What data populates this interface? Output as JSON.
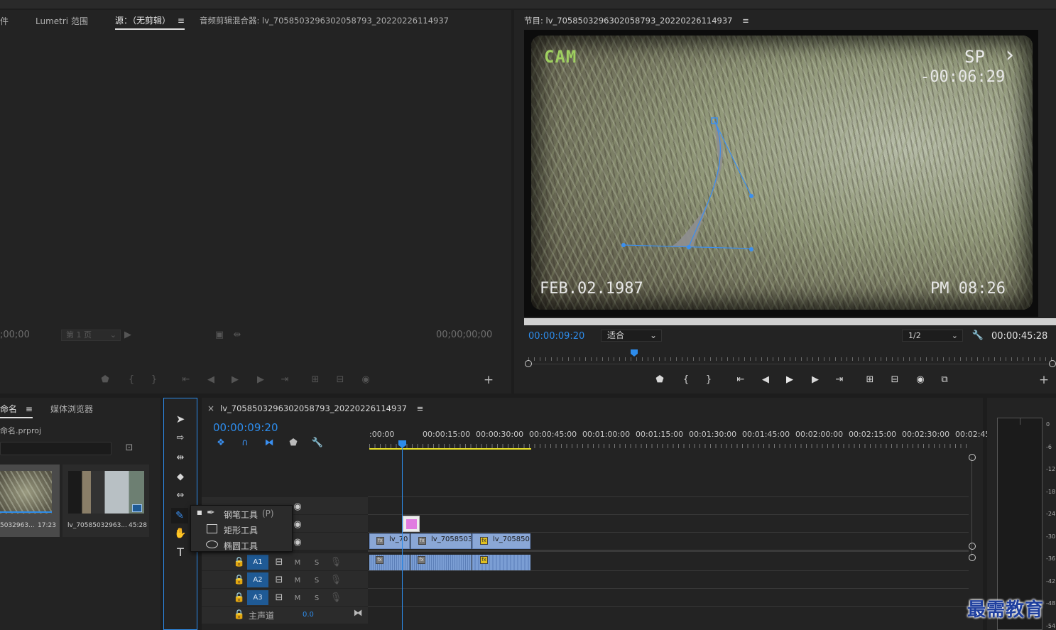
{
  "source_panel": {
    "tabs": [
      "件",
      "Lumetri 范围",
      "源：（无剪辑）",
      "音频剪辑混合器: lv_7058503296302058793_20220226114937"
    ],
    "menu_glyph": "≡",
    "timecode_left": ";00;00",
    "page_select": "第 1 页",
    "timecode_right": "00;00;00;00",
    "add": "+"
  },
  "program_panel": {
    "title": "节目: lv_7058503296302058793_20220226114937",
    "menu_glyph": "≡",
    "timecode": "00:00:09:20",
    "fit_label": "适合",
    "resolution": "1/2",
    "duration": "00:00:45:28",
    "add": "+",
    "overlay": {
      "cam": "CAM",
      "sp": "SP",
      "counter": "-00:06:29",
      "date": "FEB.02.1987",
      "time": "PM 08:26",
      "play_glyph": "›"
    }
  },
  "project_panel": {
    "tab_name": "命名",
    "tab_glyph": "≡",
    "tab_media": "媒体浏览器",
    "file_name": "命名.prproj",
    "items": [
      {
        "label": "5032963...",
        "duration": "17:23"
      },
      {
        "label": "lv_70585032963...",
        "duration": "45:28"
      }
    ]
  },
  "tools_menu": {
    "items": [
      {
        "label": "钢笔工具",
        "shortcut": "(P)"
      },
      {
        "label": "矩形工具",
        "shortcut": ""
      },
      {
        "label": "椭圆工具",
        "shortcut": ""
      }
    ]
  },
  "timeline": {
    "close": "×",
    "sequence_name": "lv_7058503296302058793_20220226114937",
    "menu_glyph": "≡",
    "timecode": "00:00:09:20",
    "ruler": [
      ":00:00",
      "00:00:15:00",
      "00:00:30:00",
      "00:00:45:00",
      "00:01:00:00",
      "00:01:15:00",
      "00:01:30:00",
      "00:01:45:00",
      "00:02:00:00",
      "00:02:15:00",
      "00:02:30:00",
      "00:02:45:"
    ],
    "video_clips": [
      "lv_70",
      "lv_70585032",
      "lv_7058503"
    ],
    "audio_tracks": [
      {
        "name": "A1",
        "m": "M",
        "s": "S"
      },
      {
        "name": "A2",
        "m": "M",
        "s": "S"
      },
      {
        "name": "A3",
        "m": "M",
        "s": "S"
      }
    ],
    "master_label": "主声道",
    "master_value": "0.0",
    "fx": "fx"
  },
  "meters": {
    "ticks": [
      "0",
      "-6",
      "-12",
      "-18",
      "-24",
      "-30",
      "-36",
      "-42",
      "-48",
      "-54"
    ]
  },
  "watermark": "最需教育",
  "colors": {
    "accent": "#2d8ceb",
    "panel": "#232323",
    "clip": "#8aa7d6",
    "work_area": "#e8e02a",
    "text_graphic": "#e07be0"
  }
}
